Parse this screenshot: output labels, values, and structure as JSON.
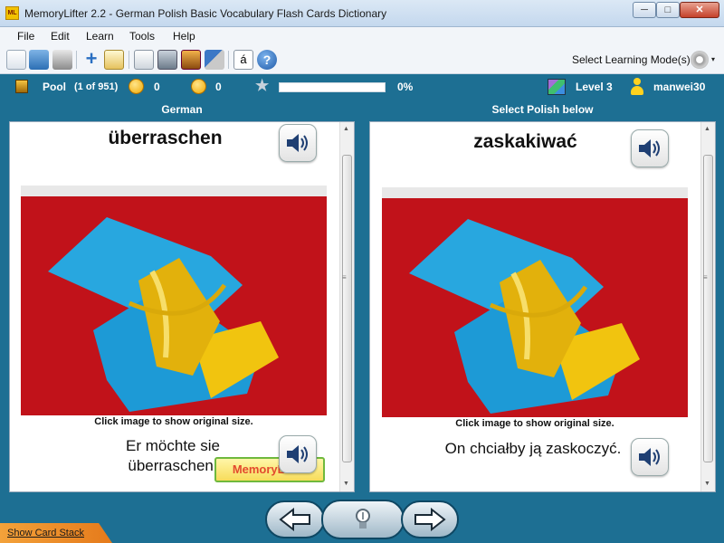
{
  "window": {
    "app_icon": "ML",
    "title": "MemoryLifter 2.2 - German Polish Basic Vocabulary Flash Cards Dictionary",
    "minimize": "─",
    "maximize": "□",
    "close": "✕"
  },
  "menu": [
    "File",
    "Edit",
    "Learn",
    "Tools",
    "Help"
  ],
  "toolbar": {
    "icons": [
      "new-icon",
      "open-icon",
      "print-icon",
      "add-card-icon",
      "edit-icon",
      "slideshow-icon",
      "learn-icon",
      "statistics-icon",
      "tools-icon",
      "special-char-icon",
      "help-icon"
    ],
    "special_char": "á",
    "help": "?",
    "learning_mode_label": "Select Learning Mode(s)",
    "dropdown_arrow": "▾"
  },
  "status": {
    "pool_label": "Pool",
    "pool_count": "(1 of 951)",
    "happy_count": "0",
    "sad_count": "0",
    "progress_percent": "0%",
    "progress_value": 0,
    "level": "Level 3",
    "user": "manwei30"
  },
  "columns": {
    "left_header": "German",
    "right_header": "Select Polish below"
  },
  "left_card": {
    "word": "überraschen",
    "caption": "Click image to show original size.",
    "sentence_line1": "Er möchte sie",
    "sentence_line2": "überraschen.",
    "watermark": "MemoryLifter"
  },
  "right_card": {
    "word": "zaskakiwać",
    "caption": "Click image to show original size.",
    "sentence": "On chciałby ją zaskoczyć."
  },
  "scroll": {
    "up": "▲",
    "down": "▼",
    "grip": "≡"
  },
  "bottom": {
    "card_stack_link": "Show Card Stack"
  },
  "colors": {
    "frame": "#1d6f93",
    "accent_orange": "#e57a1b"
  }
}
